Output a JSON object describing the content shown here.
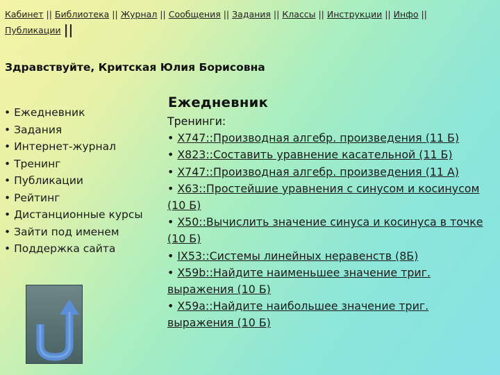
{
  "nav": {
    "items": [
      "Кабинет",
      "Библиотека",
      "Журнал",
      "Сообщения",
      "Задания",
      "Классы",
      "Инструкции",
      "Инфо",
      "Публикации"
    ],
    "separator": "||"
  },
  "greeting": "Здравствуйте, Критская Юлия Борисовна",
  "sidebar": {
    "items": [
      "• Ежедневник",
      "• Задания",
      "• Интернет-журнал",
      "• Тренинг",
      "• Публикации",
      "• Рейтинг",
      "• Дистанционные курсы",
      "• Зайти под именем",
      "• Поддержка сайта"
    ]
  },
  "main": {
    "title": "Ежедневник",
    "subtitle": "Тренинги:",
    "bullet": "• ",
    "trainings": [
      "X747::Производная алгебр. произведения (11 Б)",
      "X823::Составить уравнение касательной (11 Б)",
      "X747::Производная алгебр. произведения (11 А)",
      "X63::Простейшие уравнения с синусом и косинусом (10 Б)",
      "X50::Вычислить значение синуса и косинуса в точке (10 Б)",
      "IX53::Системы линейных неравенств (8Б)",
      "X59b::Найдите наименьшее значение триг. выражения (10 Б)",
      "X59a::Найдите наибольшее значение триг. выражения (10 Б)"
    ]
  },
  "back_button": {
    "icon": "back-arrow-icon"
  },
  "colors": {
    "bg_start": "#f4f3a6",
    "bg_end": "#86e2e6",
    "button_bg": "#5f7a7c"
  }
}
